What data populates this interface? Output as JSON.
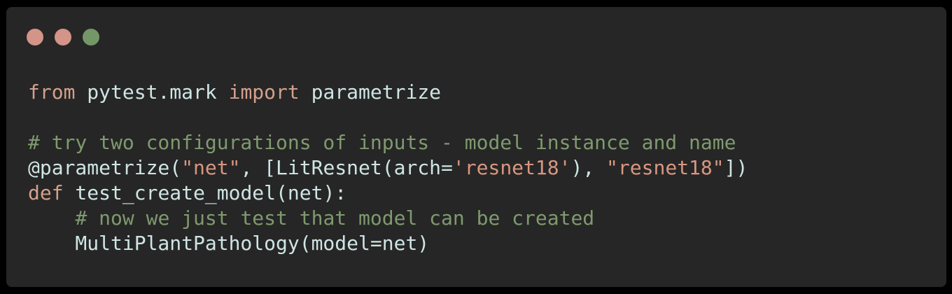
{
  "window": {
    "controls": [
      {
        "name": "close",
        "color": "#d49488"
      },
      {
        "name": "minimize",
        "color": "#d49488"
      },
      {
        "name": "maximize",
        "color": "#749768"
      }
    ]
  },
  "code": {
    "lines": [
      {
        "tokens": [
          {
            "t": "from",
            "k": "kw"
          },
          {
            "t": " pytest.mark ",
            "k": "pl"
          },
          {
            "t": "import",
            "k": "kw"
          },
          {
            "t": " parametrize",
            "k": "pl"
          }
        ]
      },
      {
        "tokens": []
      },
      {
        "tokens": [
          {
            "t": "# try two configurations of inputs - model instance and name",
            "k": "cmt"
          }
        ]
      },
      {
        "tokens": [
          {
            "t": "@parametrize(",
            "k": "pl"
          },
          {
            "t": "\"net\"",
            "k": "str"
          },
          {
            "t": ", [LitResnet(arch=",
            "k": "pl"
          },
          {
            "t": "'resnet18'",
            "k": "str"
          },
          {
            "t": "), ",
            "k": "pl"
          },
          {
            "t": "\"resnet18\"",
            "k": "str"
          },
          {
            "t": "])",
            "k": "pl"
          }
        ]
      },
      {
        "tokens": [
          {
            "t": "def",
            "k": "kw"
          },
          {
            "t": " test_create_model(net):",
            "k": "pl"
          }
        ]
      },
      {
        "tokens": [
          {
            "t": "    ",
            "k": "pl"
          },
          {
            "t": "# now we just test that model can be created",
            "k": "cmt"
          }
        ]
      },
      {
        "tokens": [
          {
            "t": "    MultiPlantPathology(model=net)",
            "k": "pl"
          }
        ]
      }
    ]
  }
}
